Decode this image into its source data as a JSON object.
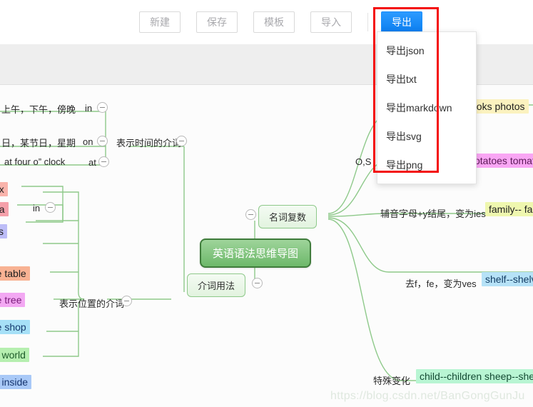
{
  "toolbar": {
    "buttons": [
      {
        "label": "新建",
        "name": "new-button"
      },
      {
        "label": "保存",
        "name": "save-button"
      },
      {
        "label": "模板",
        "name": "template-button"
      },
      {
        "label": "导入",
        "name": "import-button"
      }
    ],
    "export_label": "导出"
  },
  "export_menu": {
    "items": [
      {
        "label": "导出json"
      },
      {
        "label": "导出txt"
      },
      {
        "label": "导出markdown"
      },
      {
        "label": "导出svg"
      },
      {
        "label": "导出png"
      }
    ]
  },
  "mindmap": {
    "root": "英语语法思维导图",
    "branch_nouns": "名词复数",
    "branch_prepositions": "介词用法",
    "time_prep_label": "表示时间的介词",
    "place_prep_label": "表示位置的介词",
    "time_rows": [
      {
        "text": "上午，下午，傍晚",
        "prep": "in"
      },
      {
        "text": "日，某节日，星期",
        "prep": "on"
      },
      {
        "text": "at four o” clock",
        "prep": "at"
      }
    ],
    "place_in_prep": "in",
    "place_chips": [
      {
        "text": "ox",
        "color": "#f9b3ab"
      },
      {
        "text": "na",
        "color": "#f5a0aa"
      },
      {
        "text": "ks",
        "color": "#bdbdf7"
      },
      {
        "text": "the table",
        "color": "#f8b293"
      },
      {
        "text": " the tree",
        "color": "#f3a8f3"
      },
      {
        "text": "the shop",
        "color": "#a6e0f7"
      },
      {
        "text": "he world",
        "color": "#b6efb0"
      },
      {
        "text": "go inside",
        "color": "#a9c9f7"
      }
    ],
    "noun_rules": [
      {
        "rule": "",
        "example": "ooks photos",
        "color": "#fbf2bf"
      },
      {
        "rule": "",
        "example": "otatoes tomat",
        "color": "#f9a6f4"
      },
      {
        "rule": "辅音字母+y结尾，变为ies",
        "example": "family-- fa",
        "color": "#eff7af"
      },
      {
        "rule": "去f，fe，变为ves",
        "example": "shelf--shelve",
        "color": "#b6e2f7"
      },
      {
        "rule": "特殊变化",
        "example": "child--children sheep--sheep",
        "color": "#b8f5d3"
      }
    ],
    "left_fragment_os": "O,S"
  },
  "watermark": {
    "text": "https://blog.csdn.net/BanGongGunJu"
  },
  "colors": {
    "primary": "#1890ff",
    "annotation": "#f40d0d",
    "branch": "#8ec98a",
    "root_fill": "#6db86a"
  }
}
